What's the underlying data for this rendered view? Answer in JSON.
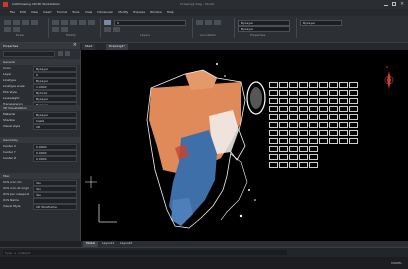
{
  "window": {
    "title": "CADDrawing 2D/3D Workstation",
    "title_right": "Drawing1.dwg - Studio"
  },
  "menu": {
    "items": [
      "File",
      "Edit",
      "View",
      "Insert",
      "Format",
      "Tools",
      "Draw",
      "Dimension",
      "Modify",
      "Express",
      "Window",
      "Help"
    ]
  },
  "ribbon": {
    "layer_value": "0",
    "color_value": "ByLayer",
    "linetype_value": "ByLayer",
    "lineweight_value": "ByLayer",
    "groups": [
      "Draw",
      "Modify",
      "Layers",
      "Annotation",
      "Properties"
    ]
  },
  "doc_tabs": [
    "Start",
    "Drawing1*"
  ],
  "sidebar": {
    "title": "Properties",
    "section_general": "General",
    "section_3d": "3D Visualization",
    "section_geometry": "Geometry",
    "section_misc": "Misc",
    "general_rows": [
      {
        "label": "Color",
        "value": "ByLayer"
      },
      {
        "label": "Layer",
        "value": "0"
      },
      {
        "label": "Linetype",
        "value": "ByLayer"
      },
      {
        "label": "Linetype scale",
        "value": "1.0000"
      },
      {
        "label": "Plot style",
        "value": "ByColor"
      },
      {
        "label": "Lineweight",
        "value": "ByLayer"
      },
      {
        "label": "Transparency",
        "value": "ByLayer"
      }
    ],
    "viz_rows": [
      {
        "label": "Material",
        "value": "ByLayer"
      },
      {
        "label": "Shadow",
        "value": "Casts"
      },
      {
        "label": "Visual style",
        "value": "2D"
      }
    ],
    "geo_rows": [
      {
        "label": "Center X",
        "value": "0.0000"
      },
      {
        "label": "Center Y",
        "value": "0.0000"
      },
      {
        "label": "Center Z",
        "value": "0.0000"
      }
    ],
    "misc_rows": [
      {
        "label": "UCS icon On",
        "value": "Yes"
      },
      {
        "label": "UCS icon at origin",
        "value": "Yes"
      },
      {
        "label": "UCS per viewport",
        "value": "Yes"
      },
      {
        "label": "UCS Name",
        "value": ""
      },
      {
        "label": "Visual Style",
        "value": "2D Wireframe"
      }
    ]
  },
  "layout_tabs": [
    "Model",
    "Layout1",
    "Layout2"
  ],
  "command": {
    "placeholder": "Type a command"
  },
  "status": {
    "coords": "",
    "model_label": "MODEL"
  },
  "compass": {
    "north_label": "N"
  },
  "colors": {
    "map_orange": "#e08a5a",
    "map_blue": "#3f6fa8",
    "map_white": "#f2f2f2",
    "map_red": "#c8432f",
    "canvas_bg": "#000000"
  }
}
